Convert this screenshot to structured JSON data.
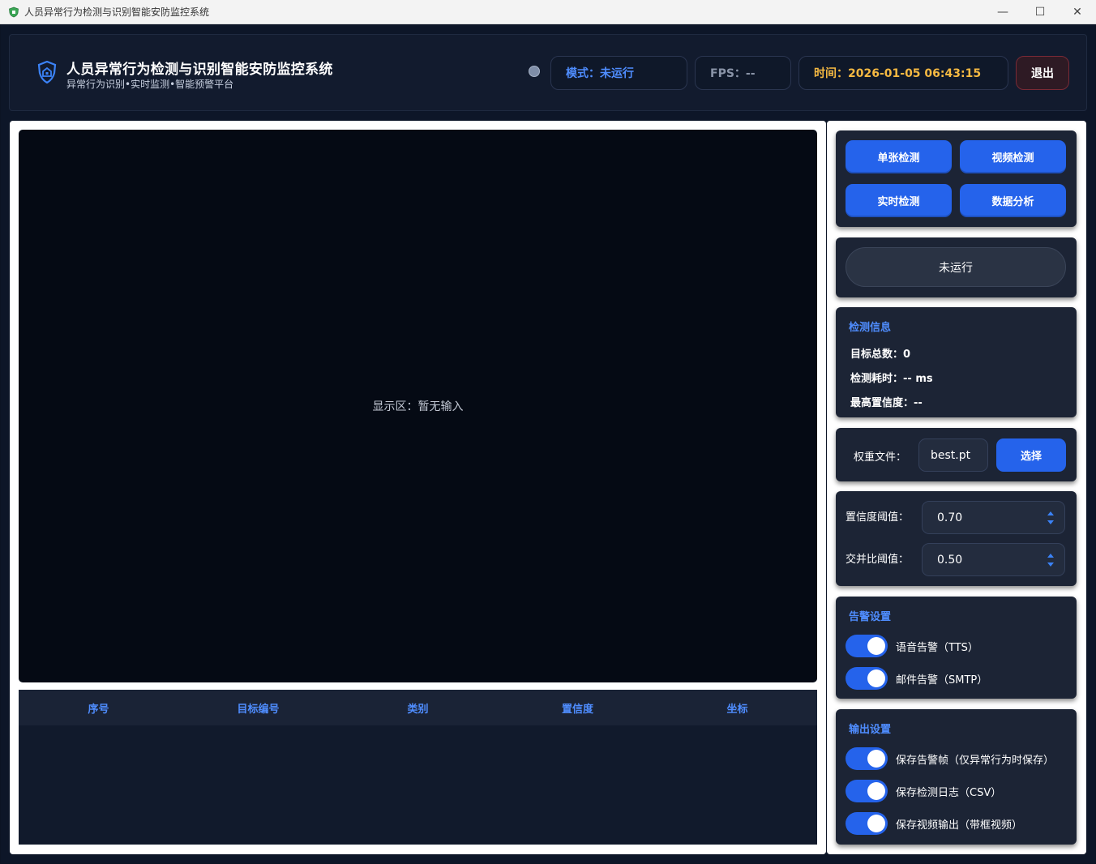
{
  "window": {
    "title": "人员异常行为检测与识别智能安防监控系统",
    "controls": {
      "minimize": "—",
      "maximize": "☐",
      "close": "✕"
    }
  },
  "header": {
    "title": "人员异常行为检测与识别智能安防监控系统",
    "subtitle": "异常行为识别•实时监测•智能预警平台",
    "mode": "模式：未运行",
    "fps": "FPS：--",
    "time": "时间：2026-01-05 06:43:15",
    "exit_label": "退出",
    "status_dot_color": "#7f8ea8"
  },
  "display": {
    "placeholder": "显示区：暂无输入"
  },
  "table": {
    "columns": [
      "序号",
      "目标编号",
      "类别",
      "置信度",
      "坐标"
    ],
    "rows": []
  },
  "modes": {
    "single": "单张检测",
    "video": "视频检测",
    "realtime": "实时检测",
    "analysis": "数据分析"
  },
  "run_status": "未运行",
  "detect_info": {
    "title": "检测信息",
    "total": "目标总数：0",
    "time_cost": "检测耗时：-- ms",
    "max_conf": "最高置信度：--"
  },
  "weights": {
    "label": "权重文件：",
    "value": "best.pt",
    "button": "选择"
  },
  "thresholds": {
    "conf_label": "置信度阈值：",
    "conf_value": "0.70",
    "iou_label": "交并比阈值：",
    "iou_value": "0.50"
  },
  "alarm": {
    "title": "告警设置",
    "tts": "语音告警（TTS）",
    "mail": "邮件告警（SMTP）",
    "tts_on": true,
    "mail_on": true
  },
  "output": {
    "title": "输出设置",
    "save_frames": "保存告警帧（仅异常行为时保存）",
    "save_log": "保存检测日志（CSV）",
    "save_video": "保存视频输出（带框视频）",
    "frames_on": true,
    "log_on": true,
    "video_on": true
  },
  "colors": {
    "accent": "#2563eb",
    "accent_text": "#4f8dff",
    "time_text": "#f5b942",
    "background": "#0d1628",
    "card": "#1c2435"
  },
  "icons": {
    "app": "shield-icon",
    "logo": "shield-house-icon"
  }
}
